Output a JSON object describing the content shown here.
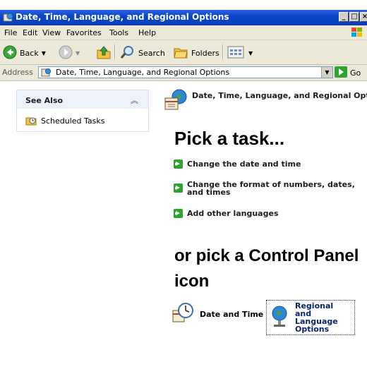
{
  "window": {
    "title": "Date, Time, Language, and Regional Options",
    "buttons": [
      "_",
      "□",
      "×"
    ]
  },
  "menu": [
    "File",
    "Edit",
    "View",
    "Favorites",
    "Tools",
    "Help"
  ],
  "toolbar": {
    "back": "Back",
    "search": "Search",
    "folders": "Folders"
  },
  "address": {
    "label": "Address",
    "value": "Date, Time, Language, and Regional Options",
    "go": "Go"
  },
  "see_also": {
    "title": "See Also",
    "items": [
      "Scheduled Tasks"
    ]
  },
  "category": {
    "title": "Date, Time, Language, and Regional Options"
  },
  "pick_task": {
    "heading": "Pick a task...",
    "tasks": [
      "Change the date and time",
      "Change the format of numbers, dates, and times",
      "Add other languages"
    ]
  },
  "control_panel": {
    "heading": "or pick a Control Panel icon",
    "icons": [
      {
        "label": "Date and Time",
        "icon": "clock-icon"
      },
      {
        "label": "Regional and Language Options",
        "icon": "globe-icon"
      }
    ]
  },
  "colors": {
    "titlebar": "#0a46c8",
    "task_arrow": "#2fa32f",
    "selected_label": "#0a246a"
  }
}
